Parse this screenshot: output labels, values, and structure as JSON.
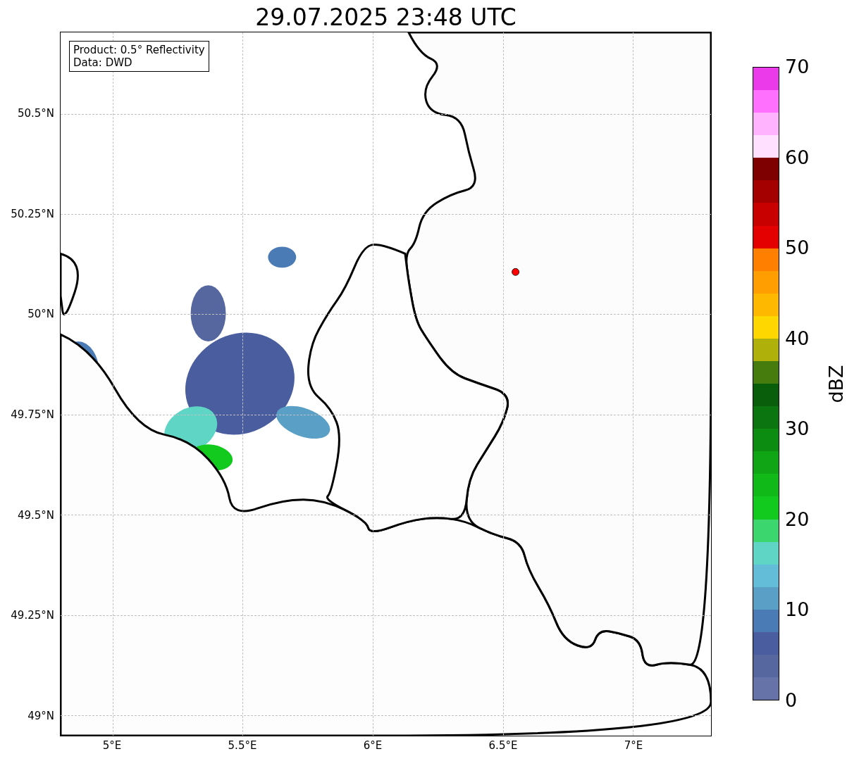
{
  "title": "29.07.2025 23:48 UTC",
  "legend": {
    "lines": [
      "Product: 0.5° Reflectivity",
      "Data: DWD"
    ]
  },
  "x_ticks": [
    "5°E",
    "5.5°E",
    "6°E",
    "6.5°E",
    "7°E"
  ],
  "y_ticks": [
    "50.5°N",
    "50.25°N",
    "50°N",
    "49.75°N",
    "49.5°N",
    "49.25°N",
    "49°N"
  ],
  "colorbar": {
    "label": "dBZ",
    "ticks": [
      "70",
      "60",
      "50",
      "40",
      "30",
      "20",
      "10",
      "0"
    ],
    "segments": [
      {
        "color": "#6673a8"
      },
      {
        "color": "#56679f"
      },
      {
        "color": "#4a5d9e"
      },
      {
        "color": "#4a7bb5"
      },
      {
        "color": "#5a9fc6"
      },
      {
        "color": "#63bcd8"
      },
      {
        "color": "#5fd5c5"
      },
      {
        "color": "#3cd66e"
      },
      {
        "color": "#12c91d"
      },
      {
        "color": "#10b818"
      },
      {
        "color": "#0fa514"
      },
      {
        "color": "#0c8c10"
      },
      {
        "color": "#0b7510"
      },
      {
        "color": "#085e0a"
      },
      {
        "color": "#467c0e"
      },
      {
        "color": "#b0b00a"
      },
      {
        "color": "#ffd700"
      },
      {
        "color": "#ffb800"
      },
      {
        "color": "#ff9e00"
      },
      {
        "color": "#ff8000"
      },
      {
        "color": "#e50000"
      },
      {
        "color": "#c80000"
      },
      {
        "color": "#a50000"
      },
      {
        "color": "#7f0000"
      },
      {
        "color": "#ffe0ff"
      },
      {
        "color": "#ffb3ff"
      },
      {
        "color": "#ff70ff"
      },
      {
        "color": "#ea3aea"
      }
    ]
  }
}
